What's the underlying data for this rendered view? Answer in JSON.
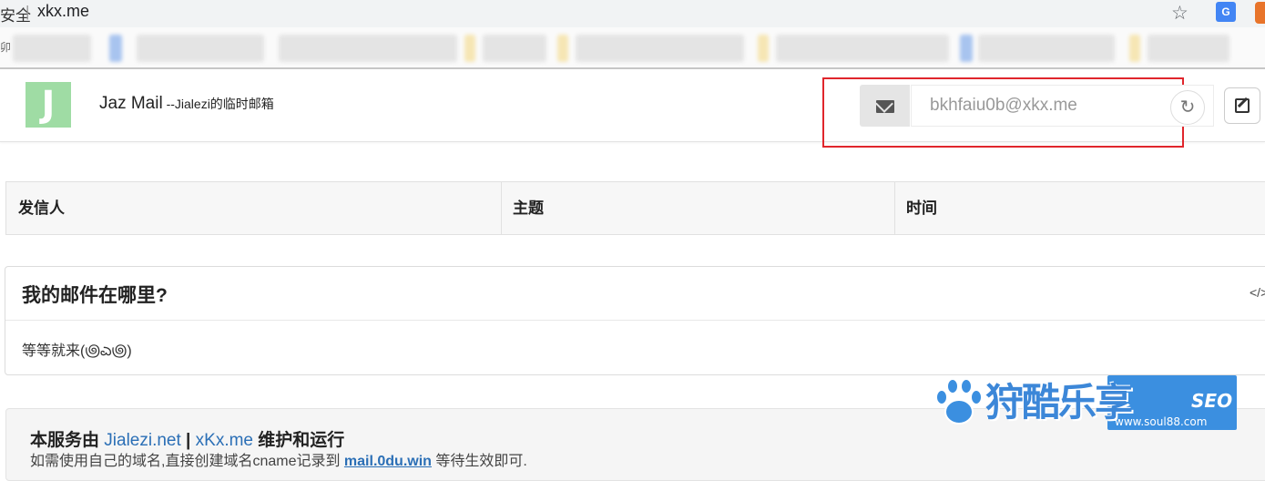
{
  "browser": {
    "address_prefix": "安全",
    "address_separator": "|",
    "url": "xkx.me",
    "star_glyph": "☆",
    "extension_label": "G",
    "bookmark_prefix": "卯"
  },
  "header": {
    "logo_letter": "J",
    "brand_name": "Jaz Mail",
    "brand_sub": " --Jialezi的临时邮箱",
    "email_value": "bkhfaiu0b@xkx.me",
    "refresh_glyph": "↻"
  },
  "table": {
    "columns": [
      "发信人",
      "主题",
      "时间"
    ]
  },
  "panel": {
    "title": "我的邮件在哪里?",
    "code_glyph": "</>",
    "body": "等等就来(಄ಎ಄)"
  },
  "footer": {
    "line1_prefix": "本服务由 ",
    "link1": "Jialezi.net",
    "sep": " | ",
    "link2": "xKx.me",
    "line1_suffix": " 维护和运行",
    "line2_prefix": "如需使用自己的域名,直接创建域名cname记录到 ",
    "line2_link": "mail.0du.win",
    "line2_suffix": " 等待生效即可."
  },
  "watermark": {
    "title": "狩酷乐享",
    "tag": "SEO",
    "url": "www.soul88.com"
  },
  "colors": {
    "highlight": "#e0262c",
    "link": "#2b6fb6",
    "logo": "#9fdca4",
    "watermark": "#3b8fe0"
  }
}
